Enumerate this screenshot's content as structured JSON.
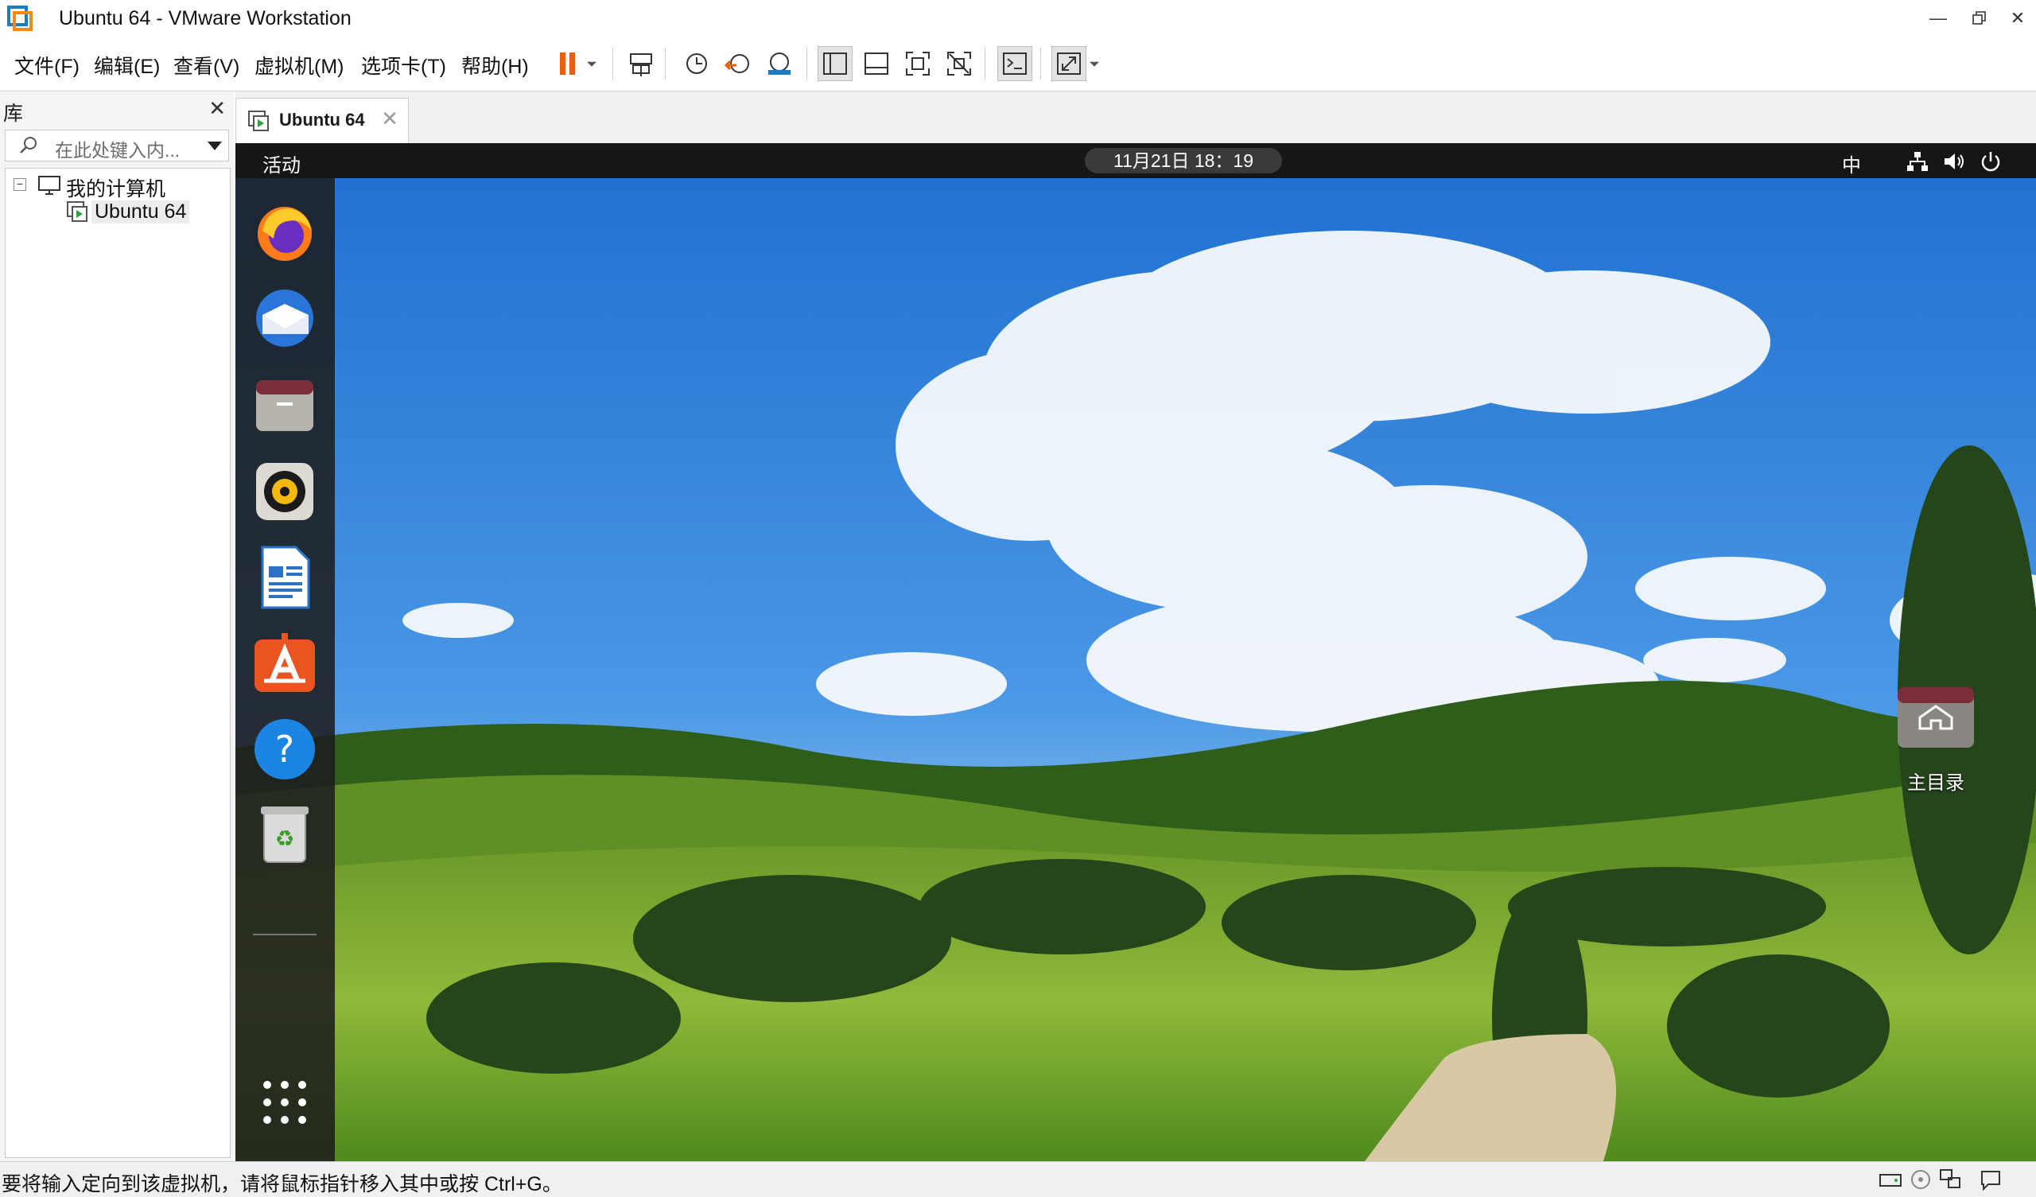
{
  "window": {
    "title": "Ubuntu 64 - VMware Workstation",
    "app_icon": "vmware-icon"
  },
  "menubar": {
    "items": [
      {
        "label": "文件(F)"
      },
      {
        "label": "编辑(E)"
      },
      {
        "label": "查看(V)"
      },
      {
        "label": "虚拟机(M)"
      },
      {
        "label": "选项卡(T)"
      },
      {
        "label": "帮助(H)"
      }
    ]
  },
  "toolbar": {
    "icons": [
      "pause-icon",
      "send-ctrl-alt-del-icon",
      "snapshot-icon",
      "revert-snapshot-icon",
      "snapshot-manager-icon",
      "show-library-icon",
      "thumbnail-bar-icon",
      "full-screen-icon",
      "unity-icon",
      "console-view-icon",
      "stretch-guest-icon"
    ],
    "accent_color": "#e8600a"
  },
  "library": {
    "title": "库",
    "search_placeholder": "在此处键入内...",
    "tree": {
      "root": "我的计算机",
      "child": "Ubuntu 64"
    }
  },
  "tab": {
    "label": "Ubuntu 64"
  },
  "guest": {
    "activities": "活动",
    "clock": "11月21日  18：19",
    "ime": "中",
    "dock_apps": [
      "firefox-icon",
      "thunderbird-icon",
      "files-icon",
      "rhythmbox-icon",
      "libreoffice-writer-icon",
      "software-center-icon",
      "help-icon",
      "trash-icon"
    ],
    "desktop_home_label": "主目录"
  },
  "statusbar": {
    "text": "要将输入定向到该虚拟机，请将鼠标指针移入其中或按 Ctrl+G。"
  }
}
